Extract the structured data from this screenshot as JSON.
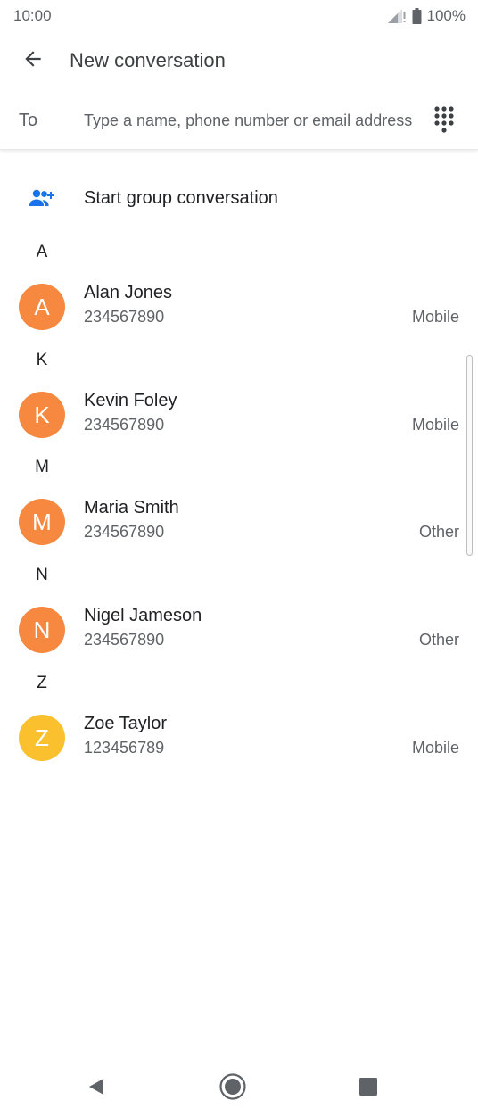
{
  "status_bar": {
    "time": "10:00",
    "battery": "100%"
  },
  "app_bar": {
    "title": "New conversation",
    "back_icon": "arrow-back-icon"
  },
  "to_field": {
    "label": "To",
    "placeholder": "Type a name, phone number or email address",
    "value": "",
    "dialpad_icon": "dialpad-icon"
  },
  "group": {
    "label": "Start group conversation",
    "icon": "group-add-icon"
  },
  "sections": [
    {
      "letter": "A",
      "contacts": [
        {
          "initial": "A",
          "name": "Alan Jones",
          "number": "234567890",
          "type": "Mobile",
          "color": "#F6883F"
        }
      ]
    },
    {
      "letter": "K",
      "contacts": [
        {
          "initial": "K",
          "name": "Kevin Foley",
          "number": "234567890",
          "type": "Mobile",
          "color": "#F6883F"
        }
      ]
    },
    {
      "letter": "M",
      "contacts": [
        {
          "initial": "M",
          "name": "Maria Smith",
          "number": "234567890",
          "type": "Other",
          "color": "#F6883F"
        }
      ]
    },
    {
      "letter": "N",
      "contacts": [
        {
          "initial": "N",
          "name": "Nigel Jameson",
          "number": "234567890",
          "type": "Other",
          "color": "#F6883F"
        }
      ]
    },
    {
      "letter": "Z",
      "contacts": [
        {
          "initial": "Z",
          "name": "Zoe Taylor",
          "number": "123456789",
          "type": "Mobile",
          "color": "#FBC02D"
        }
      ]
    }
  ],
  "colors": {
    "accent": "#1A73E8",
    "avatar_orange": "#F6883F",
    "avatar_yellow": "#FBC02D"
  },
  "nav_bar": {
    "back_icon": "nav-back-icon",
    "home_icon": "nav-home-icon",
    "recents_icon": "nav-recents-icon"
  }
}
